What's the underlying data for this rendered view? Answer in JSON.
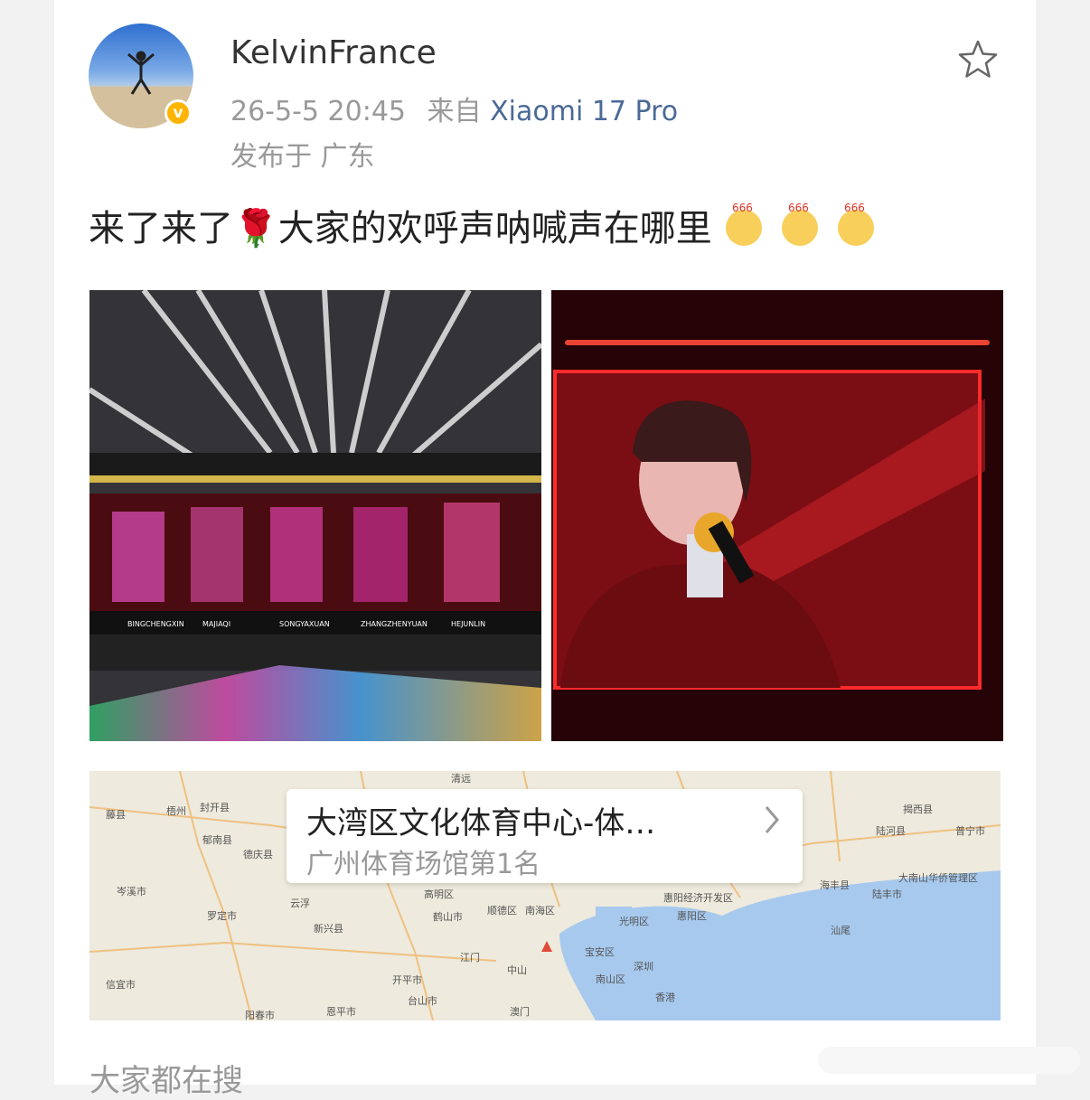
{
  "post": {
    "username": "KelvinFrance",
    "timestamp": "26-5-5 20:45",
    "source_prefix": "来自",
    "source_device": "Xiaomi 17 Pro",
    "location": "发布于 广东",
    "text": "来了来了🌹大家的欢呼声呐喊声在哪里",
    "emoji_label": "666",
    "verified_badge": "v"
  },
  "photos": {
    "stage_names": [
      "BINGCHENGXIN",
      "MAJIAQI",
      "SONGYAXUAN",
      "ZHANGZHENYUAN",
      "HEJUNLIN"
    ]
  },
  "map": {
    "place_title": "大湾区文化体育中心-体…",
    "place_subtitle": "广州体育场馆第1名",
    "labels": [
      "清远",
      "封开县",
      "梧州",
      "藤县",
      "郁南县",
      "德庆县",
      "岑溪市",
      "罗定市",
      "云浮",
      "新兴县",
      "信宜市",
      "阳春市",
      "恩平市",
      "开平市",
      "台山市",
      "江门",
      "鹤山市",
      "高明区",
      "顺德区",
      "南海区",
      "中山",
      "澳门",
      "宝安区",
      "光明区",
      "深圳",
      "香港",
      "南山区",
      "惠阳区",
      "惠阳经济开发区",
      "揭西县",
      "陆河县",
      "普宁市",
      "海丰县",
      "陆丰市",
      "汕尾",
      "大南山华侨管理区"
    ]
  },
  "footer": {
    "trending_label": "大家都在搜"
  },
  "colors": {
    "link": "#4a6a96",
    "badge": "#ffb400",
    "muted": "#999999"
  },
  "icons": [
    "star-icon",
    "verified-icon",
    "rose-emoji",
    "666-emoji",
    "chevron-right-icon",
    "map-pin-icon"
  ]
}
